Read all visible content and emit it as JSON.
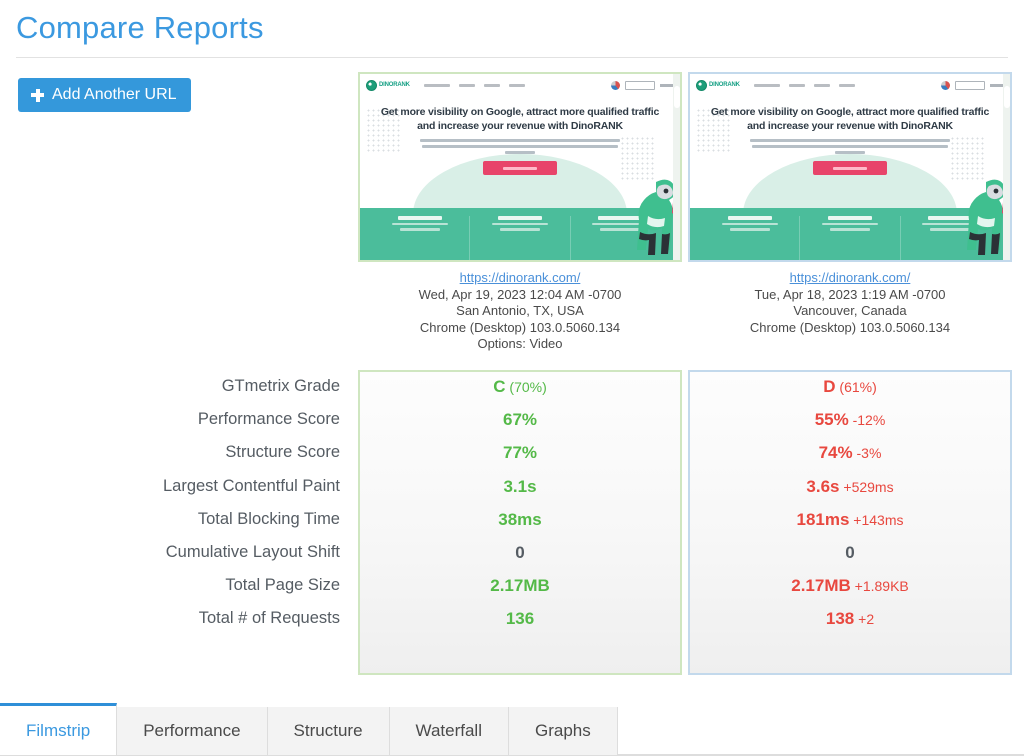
{
  "header": {
    "title": "Compare Reports"
  },
  "toolbar": {
    "add_url_label": "Add Another URL",
    "add_url_icon": "plus-icon",
    "accent_color": "#3498db"
  },
  "reports": [
    {
      "side": "left",
      "url": "https://dinorank.com/",
      "date": "Wed, Apr 19, 2023 12:04 AM -0700",
      "location": "San Antonio, TX, USA",
      "browser": "Chrome (Desktop) 103.0.5060.134",
      "options": "Options: Video",
      "accent_color": "#cfe6c0"
    },
    {
      "side": "right",
      "url": "https://dinorank.com/",
      "date": "Tue, Apr 18, 2023 1:19 AM -0700",
      "location": "Vancouver, Canada",
      "browser": "Chrome (Desktop) 103.0.5060.134",
      "options": "",
      "accent_color": "#c3d9ec"
    }
  ],
  "thumbnail": {
    "headline": "Get more visibility on Google, attract more qualified traffic and increase your revenue with DinoRANK",
    "brand": "DINORANK"
  },
  "metrics": {
    "rows": [
      {
        "label": "GTmetrix Grade",
        "left": {
          "main": "C",
          "sub": "(70%)",
          "state": "good"
        },
        "right": {
          "main": "D",
          "sub": "(61%)",
          "state": "bad"
        }
      },
      {
        "label": "Performance Score",
        "left": {
          "main": "67%",
          "sub": "",
          "state": "good"
        },
        "right": {
          "main": "55%",
          "sub": "-12%",
          "state": "bad"
        }
      },
      {
        "label": "Structure Score",
        "left": {
          "main": "77%",
          "sub": "",
          "state": "good"
        },
        "right": {
          "main": "74%",
          "sub": "-3%",
          "state": "bad"
        }
      },
      {
        "label": "Largest Contentful Paint",
        "left": {
          "main": "3.1s",
          "sub": "",
          "state": "good"
        },
        "right": {
          "main": "3.6s",
          "sub": "+529ms",
          "state": "bad"
        }
      },
      {
        "label": "Total Blocking Time",
        "left": {
          "main": "38ms",
          "sub": "",
          "state": "good"
        },
        "right": {
          "main": "181ms",
          "sub": "+143ms",
          "state": "bad"
        }
      },
      {
        "label": "Cumulative Layout Shift",
        "left": {
          "main": "0",
          "sub": "",
          "state": "neutral"
        },
        "right": {
          "main": "0",
          "sub": "",
          "state": "neutral"
        }
      },
      {
        "label": "Total Page Size",
        "left": {
          "main": "2.17MB",
          "sub": "",
          "state": "good"
        },
        "right": {
          "main": "2.17MB",
          "sub": "+1.89KB",
          "state": "bad"
        }
      },
      {
        "label": "Total # of Requests",
        "left": {
          "main": "136",
          "sub": "",
          "state": "good"
        },
        "right": {
          "main": "138",
          "sub": "+2",
          "state": "bad"
        }
      }
    ],
    "good_color": "#54b948",
    "bad_color": "#e8483f"
  },
  "tabs": [
    {
      "label": "Filmstrip",
      "active": true
    },
    {
      "label": "Performance",
      "active": false
    },
    {
      "label": "Structure",
      "active": false
    },
    {
      "label": "Waterfall",
      "active": false
    },
    {
      "label": "Graphs",
      "active": false
    }
  ]
}
